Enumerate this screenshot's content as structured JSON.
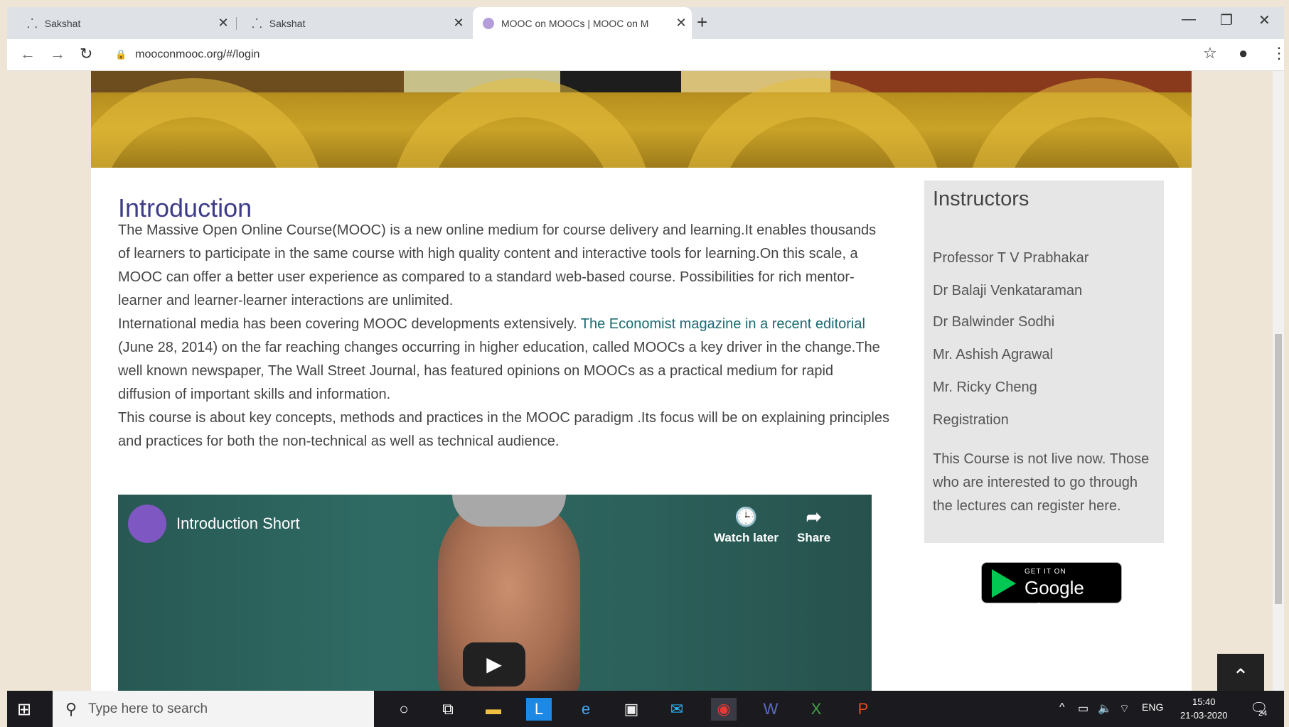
{
  "browser": {
    "tabs": [
      {
        "title": "Sakshat",
        "icon": "sakshat-icon",
        "active": false
      },
      {
        "title": "Sakshat",
        "icon": "sakshat-icon",
        "active": false
      },
      {
        "title": "MOOC on MOOCs | MOOC on M",
        "icon": "site-icon",
        "active": true
      }
    ],
    "new_tab": "+",
    "url": "mooconmooc.org/#/login"
  },
  "page": {
    "intro_title": "Introduction",
    "para1": "The Massive Open Online Course(MOOC) is a new online medium for course delivery and learning.It enables thousands of learners to participate in the same course with high quality content and interactive tools for learning.On this scale, a MOOC can offer a better user experience as compared to a standard web-based course. Possibilities for rich mentor-learner and learner-learner interactions are unlimited.",
    "para2_before": "International media has been covering MOOC developments extensively. ",
    "para2_link": "The Economist magazine in a recent editorial",
    "para2_after": " (June 28, 2014) on the far reaching changes occurring in higher education, called MOOCs a key driver in the change.The well known newspaper, The Wall Street Journal, has featured opinions on MOOCs as a practical medium for rapid diffusion of important skills and information.",
    "para3": "This course is about key concepts, methods and practices in the MOOC paradigm .Its focus will be on explaining principles and practices for both the non-technical as well as technical audience.",
    "video": {
      "title": "Introduction Short",
      "watch_later": "Watch later",
      "share": "Share"
    },
    "sidebar": {
      "heading": "Instructors",
      "instructors": [
        "Professor T V Prabhakar",
        "Dr Balaji Venkataraman",
        "Dr Balwinder Sodhi",
        "Mr. Ashish Agrawal",
        "Mr. Ricky Cheng"
      ],
      "registration": "Registration",
      "note": "This Course is not live now. Those who are interested to go through the lectures can register here."
    },
    "google_play": {
      "small": "GET IT ON",
      "big": "Google Play"
    }
  },
  "taskbar": {
    "search_placeholder": "Type here to search",
    "lang": "ENG",
    "time": "15:40",
    "date": "21-03-2020",
    "notification_count": "24"
  }
}
